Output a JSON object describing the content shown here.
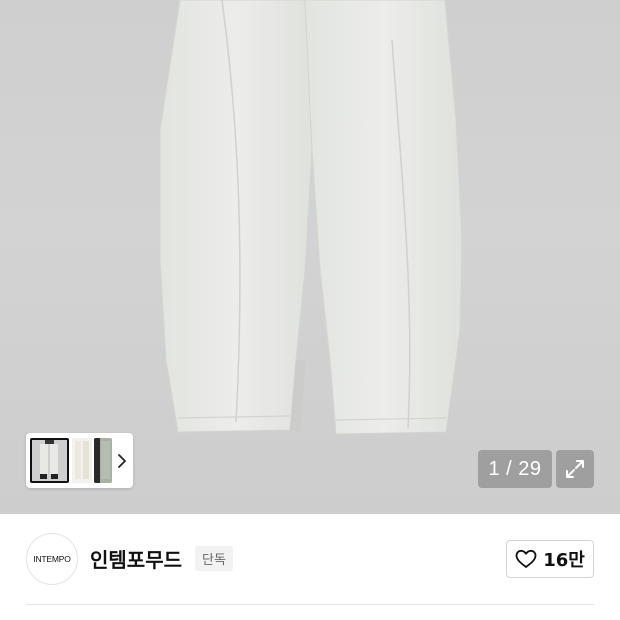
{
  "gallery": {
    "counter": "1 / 29",
    "thumbnails": [
      "product-photo-thumb",
      "product-front-thumb",
      "product-color-thumb"
    ],
    "icons": {
      "next": "chevron-right-icon",
      "expand": "expand-icon"
    }
  },
  "brand": {
    "logo_text": "INTEMPO",
    "name": "인템포무드",
    "badge": "단독"
  },
  "like": {
    "icon": "heart-icon",
    "count": "16만"
  },
  "colors": {
    "hero_bg": "#cfcfcf",
    "pants": "#e6e8e4",
    "overlay": "#8a8a8a"
  }
}
